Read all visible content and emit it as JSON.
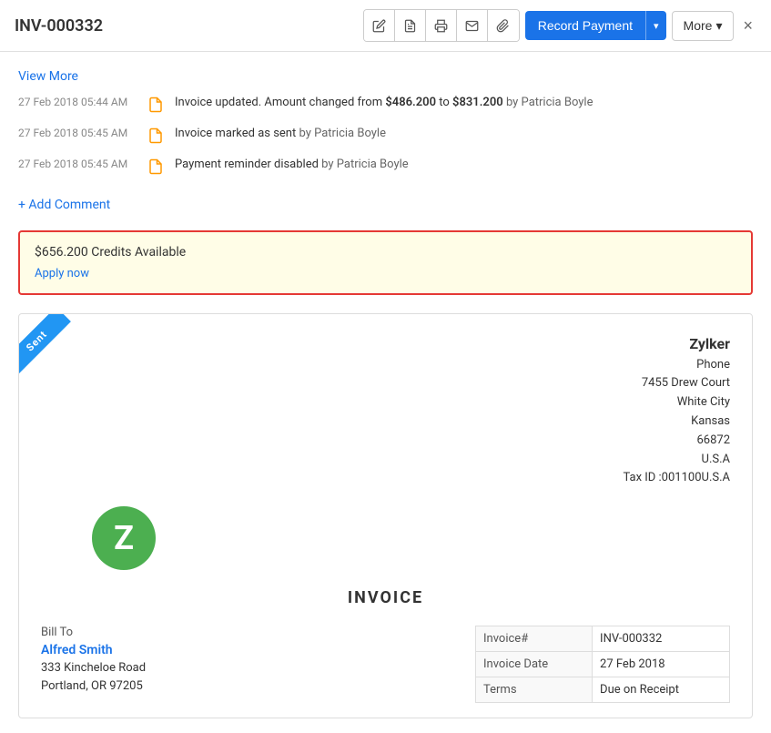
{
  "header": {
    "title": "INV-000332",
    "icons": {
      "edit": "✏",
      "pdf": "📄",
      "print": "🖨",
      "mail": "✉",
      "attach": "📎"
    },
    "record_payment_label": "Record Payment",
    "more_label": "More",
    "close_label": "×",
    "dropdown_arrow": "▾"
  },
  "activity": {
    "view_more_label": "View More",
    "items": [
      {
        "time": "27 Feb 2018 05:44 AM",
        "text_before": "Invoice updated. Amount changed from ",
        "amount_from": "$486.200",
        "text_middle": " to ",
        "amount_to": "$831.200",
        "by_label": " by ",
        "author": "Patricia Boyle"
      },
      {
        "time": "27 Feb 2018 05:45 AM",
        "text_before": "Invoice marked as sent",
        "by_label": " by ",
        "author": "Patricia Boyle"
      },
      {
        "time": "27 Feb 2018 05:45 AM",
        "text_before": "Payment reminder disabled",
        "by_label": " by ",
        "author": "Patricia Boyle"
      }
    ],
    "add_comment_label": "+ Add Comment"
  },
  "credits": {
    "text": "$656.200 Credits Available",
    "apply_now_label": "Apply now"
  },
  "invoice": {
    "status_ribbon": "Sent",
    "company": {
      "name": "Zylker",
      "phone_label": "Phone",
      "address_line1": "7455 Drew Court",
      "address_line2": "White City",
      "state": "Kansas",
      "zip": "66872",
      "country": "U.S.A",
      "tax_id": "Tax ID :001100U.S.A"
    },
    "logo_letter": "Z",
    "title": "INVOICE",
    "bill_to": {
      "label": "Bill To",
      "name": "Alfred Smith",
      "address_line1": "333 Kincheloe Road",
      "address_line2": "Portland, OR 97205"
    },
    "details": [
      {
        "label": "Invoice#",
        "value": "INV-000332"
      },
      {
        "label": "Invoice Date",
        "value": "27 Feb 2018"
      },
      {
        "label": "Terms",
        "value": "Due on Receipt"
      }
    ]
  }
}
